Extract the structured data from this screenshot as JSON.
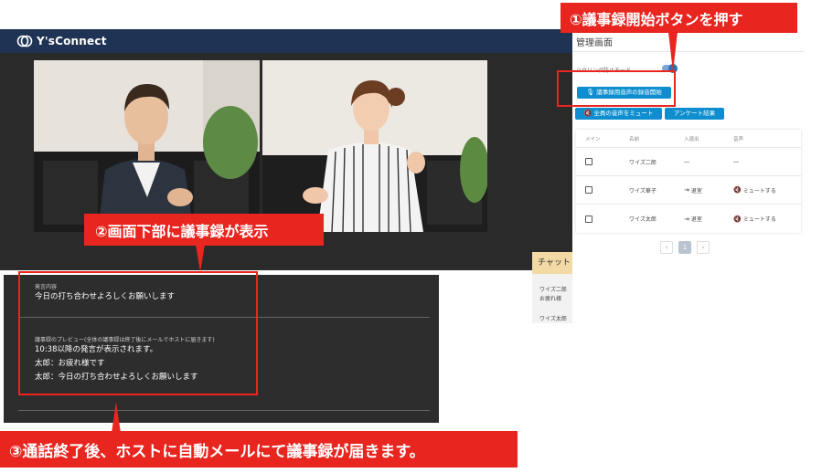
{
  "app": {
    "logo_text": "Y'sConnect",
    "header_color": "#1f3454"
  },
  "admin": {
    "title": "管理画面",
    "toggle_label": "ハウリング防止モード",
    "record_button": "議事録用音声の録音開始",
    "mute_all_button": "全員の音声をミュート",
    "survey_button": "アンケート結果",
    "table": {
      "headers": [
        "メイン",
        "名前",
        "入退出",
        "音声"
      ],
      "rows": [
        {
          "name": "ワイズ二郎",
          "entry": "―",
          "audio": "―"
        },
        {
          "name": "ワイズ華子",
          "entry": "退室",
          "audio": "ミュートする"
        },
        {
          "name": "ワイズ太郎",
          "entry": "退室",
          "audio": "ミュートする"
        }
      ]
    },
    "pager": {
      "prev": "‹",
      "current": "1",
      "next": "›"
    }
  },
  "chat": {
    "title": "チャット",
    "lines": [
      "ワイズ二郎",
      "お疲れ様",
      "ワイズ太郎"
    ]
  },
  "transcript": {
    "speech_label": "発言内容",
    "speech_text": "今日の打ち合わせよろしくお願いします",
    "preview_label": "議事録のプレビュー(全体の議事録は終了後にメールでホストに届きます)",
    "preview_header": "10:38以降の発言が表示されます。",
    "lines": [
      "太郎：お疲れ様です",
      "太郎：今日の打ち合わせよろしくお願いします"
    ]
  },
  "annotations": {
    "step1": "①議事録開始ボタンを押す",
    "step2": "②画面下部に議事録が表示",
    "step3": "③通話終了後、ホストに自動メールにて議事録が届きます。",
    "color": "#e8251f"
  }
}
